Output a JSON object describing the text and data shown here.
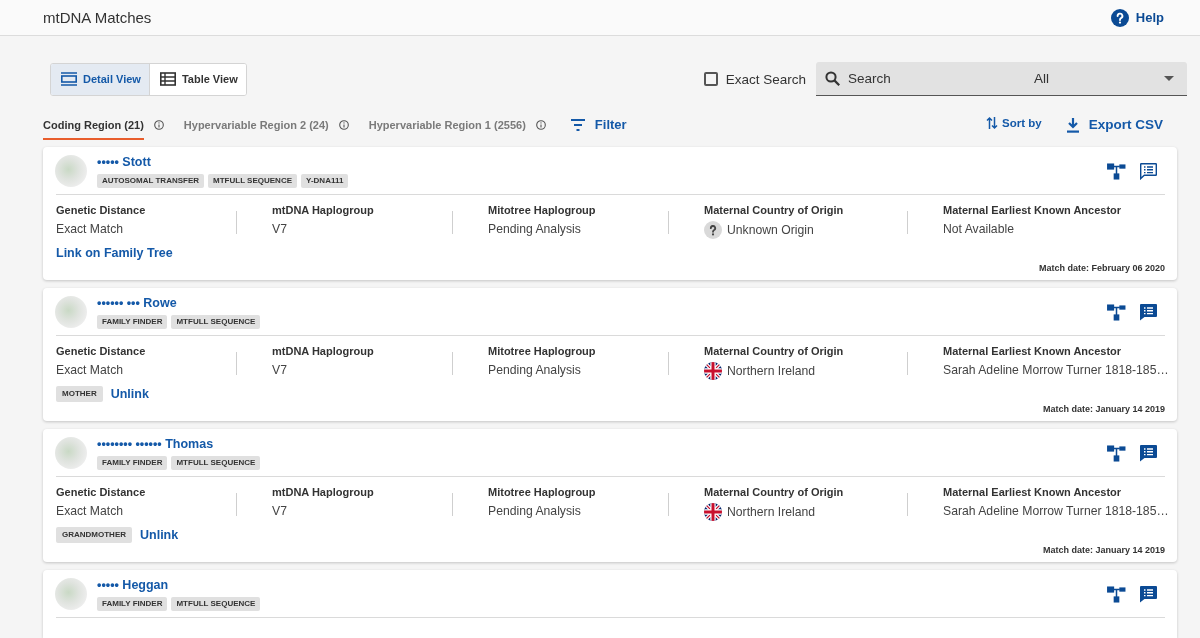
{
  "header": {
    "title": "mtDNA Matches",
    "help": "Help"
  },
  "view_options": [
    {
      "label": "Detail View",
      "kind": "detail",
      "selected": true
    },
    {
      "label": "Table View",
      "kind": "table",
      "selected": false
    }
  ],
  "exact_search": {
    "label": "Exact Search",
    "checked": false
  },
  "search": {
    "placeholder": "Search"
  },
  "scope_select": {
    "value": "All"
  },
  "tabs": [
    {
      "label": "Coding Region (21)",
      "selected": true
    },
    {
      "label": "Hypervariable Region 2 (24)",
      "selected": false
    },
    {
      "label": "Hypervariable Region 1 (2556)",
      "selected": false
    }
  ],
  "filter": {
    "label": "Filter"
  },
  "sort": {
    "label": "Sort by"
  },
  "export": {
    "label": "Export CSV"
  },
  "matches": [
    {
      "name": "••••• Stott",
      "tags": [
        "AUTOSOMAL TRANSFER",
        "MTFULL SEQUENCE",
        "Y-DNA111"
      ],
      "notes": false,
      "fields": [
        {
          "label": "Genetic Distance",
          "value": "Exact Match",
          "kind": "text"
        },
        {
          "label": "mtDNA Haplogroup",
          "value": "V7",
          "kind": "text"
        },
        {
          "label": "Mitotree Haplogroup",
          "value": "Pending Analysis",
          "kind": "text"
        },
        {
          "label": "Maternal Country of Origin",
          "value": "Unknown Origin",
          "kind": "unknown"
        },
        {
          "label": "Maternal Earliest Known Ancestor",
          "value": "Not Available",
          "kind": "text"
        }
      ],
      "tree_link": {
        "link": "Link on Family Tree"
      },
      "match_date": "Match date: February 06 2020"
    },
    {
      "name": "•••••• ••• Rowe",
      "tags": [
        "FAMILY FINDER",
        "MTFULL SEQUENCE"
      ],
      "notes": true,
      "fields": [
        {
          "label": "Genetic Distance",
          "value": "Exact Match",
          "kind": "text"
        },
        {
          "label": "mtDNA Haplogroup",
          "value": "V7",
          "kind": "text"
        },
        {
          "label": "Mitotree Haplogroup",
          "value": "Pending Analysis",
          "kind": "text"
        },
        {
          "label": "Maternal Country of Origin",
          "value": "Northern Ireland",
          "kind": "flag"
        },
        {
          "label": "Maternal Earliest Known Ancestor",
          "value": "Sarah Adeline Morrow Turner 1818-185…",
          "kind": "text"
        }
      ],
      "tree_link": {
        "relation": "MOTHER",
        "link": "Unlink"
      },
      "match_date": "Match date: January 14 2019"
    },
    {
      "name": "•••••••• •••••• Thomas",
      "tags": [
        "FAMILY FINDER",
        "MTFULL SEQUENCE"
      ],
      "notes": true,
      "fields": [
        {
          "label": "Genetic Distance",
          "value": "Exact Match",
          "kind": "text"
        },
        {
          "label": "mtDNA Haplogroup",
          "value": "V7",
          "kind": "text"
        },
        {
          "label": "Mitotree Haplogroup",
          "value": "Pending Analysis",
          "kind": "text"
        },
        {
          "label": "Maternal Country of Origin",
          "value": "Northern Ireland",
          "kind": "flag"
        },
        {
          "label": "Maternal Earliest Known Ancestor",
          "value": "Sarah Adeline Morrow Turner 1818-185…",
          "kind": "text"
        }
      ],
      "tree_link": {
        "relation": "GRANDMOTHER",
        "link": "Unlink"
      },
      "match_date": "Match date: January 14 2019"
    },
    {
      "name": "••••• Heggan",
      "tags": [
        "FAMILY FINDER",
        "MTFULL SEQUENCE"
      ],
      "notes": true
    }
  ]
}
